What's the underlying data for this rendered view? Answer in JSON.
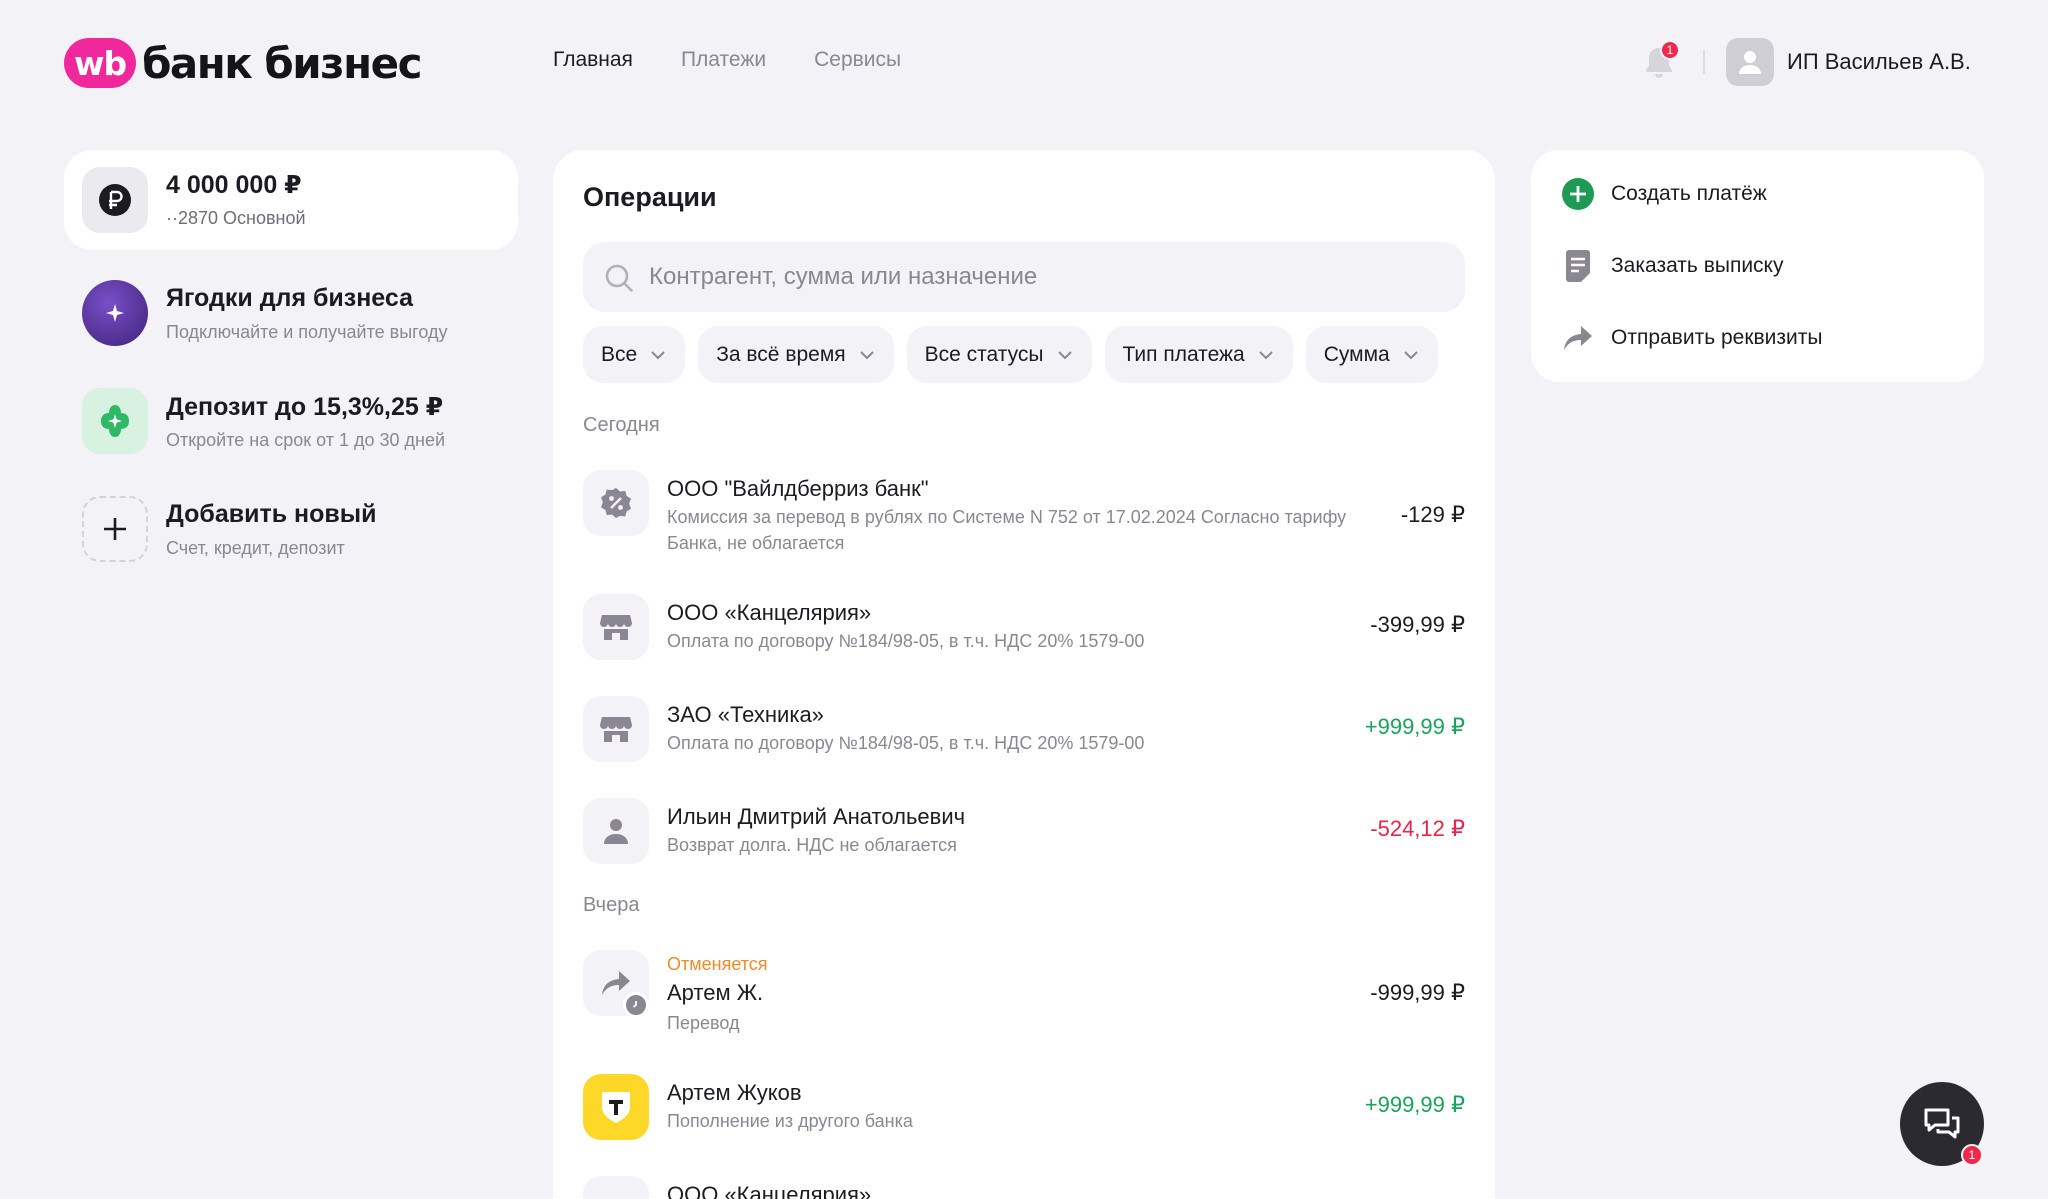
{
  "brand": {
    "wb": "wb",
    "text": "банк бизнес"
  },
  "nav": [
    {
      "label": "Главная",
      "active": true
    },
    {
      "label": "Платежи",
      "active": false
    },
    {
      "label": "Сервисы",
      "active": false
    }
  ],
  "header": {
    "notification_count": "1",
    "user_name": "ИП Васильев А.В."
  },
  "left": {
    "balance": {
      "amount": "4 000 000 ₽",
      "account": "··2870 Основной"
    },
    "items": [
      {
        "title": "Ягодки для бизнеса",
        "sub": "Подключайте и получайте выгоду"
      },
      {
        "title": "Депозит до 15,3%,25 ₽",
        "sub": "Откройте на срок от 1 до 30 дней"
      },
      {
        "title": "Добавить новый",
        "sub": "Счет, кредит, депозит"
      }
    ]
  },
  "ops": {
    "title": "Операции",
    "search_placeholder": "Контрагент, сумма или назначение",
    "filters": [
      "Все",
      "За всё время",
      "Все статусы",
      "Тип платежа",
      "Сумма"
    ],
    "today_label": "Сегодня",
    "yesterday_label": "Вчера",
    "rows": [
      {
        "name": "ООО \"Вайлдберриз банк\"",
        "desc": "Комиссия за перевод в рублях по Системе N 752 от 17.02.2024 Согласно тарифу Банка, не облагается",
        "amount": "-129 ₽"
      },
      {
        "name": "ООО «Канцелярия»",
        "desc": "Оплата по договору №184/98-05, в т.ч. НДС 20% 1579-00",
        "amount": "-399,99 ₽"
      },
      {
        "name": "ЗАО «Техника»",
        "desc": "Оплата по договору №184/98-05, в т.ч. НДС 20% 1579-00",
        "amount": "+999,99 ₽"
      },
      {
        "name": "Ильин Дмитрий Анатольевич",
        "desc": "Возврат долга. НДС не облагается",
        "amount": "-524,12 ₽"
      },
      {
        "status": "Отменяется",
        "name": "Артем Ж.",
        "desc": "Перевод",
        "amount": "-999,99 ₽"
      },
      {
        "name": "Артем Жуков",
        "desc": "Пополнение из другого банка",
        "amount": "+999,99 ₽"
      },
      {
        "name": "ООО «Канцелярия»"
      }
    ]
  },
  "actions": [
    {
      "label": "Создать платёж"
    },
    {
      "label": "Заказать выписку"
    },
    {
      "label": "Отправить реквизиты"
    }
  ],
  "chat": {
    "badge": "1"
  },
  "colors": {
    "brand": "#f0289b",
    "positive": "#1aa35b",
    "negative": "#e8264a",
    "pending": "#f08c26",
    "accent_green": "#1f9a55"
  }
}
